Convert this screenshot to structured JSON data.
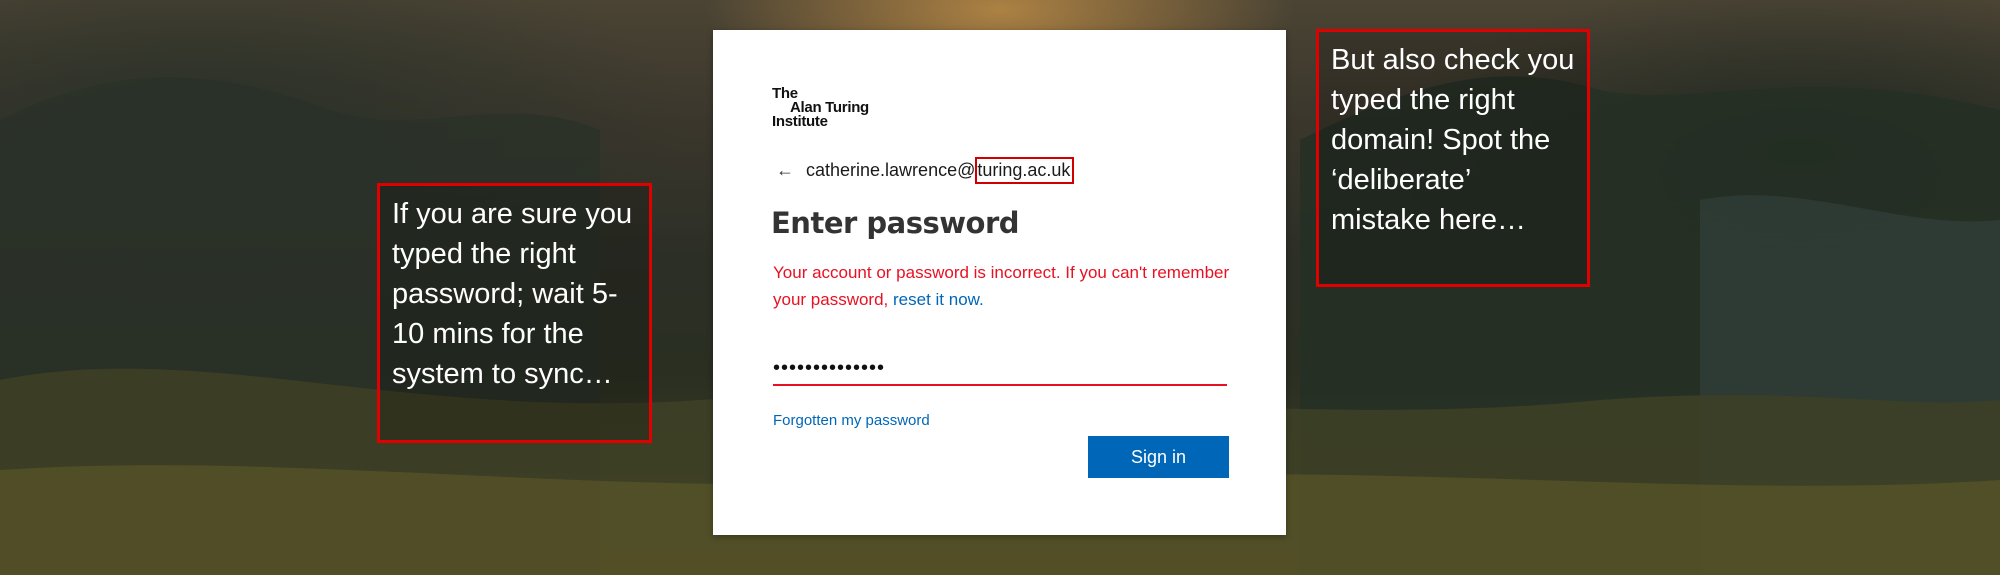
{
  "login": {
    "logo_line1": "The",
    "logo_line2": "Alan Turing",
    "logo_line3": "Institute",
    "back_arrow": "←",
    "user_prefix": "catherine.lawrence@",
    "user_domain": "turing.ac.uk",
    "title": "Enter password",
    "error_text": "Your account or password is incorrect. If you can't remember your password, ",
    "error_link": "reset it now.",
    "password_value": "••••••••••••••",
    "forgot_link": "Forgotten my password",
    "sign_in_label": "Sign in"
  },
  "annotations": {
    "left_note": "If you are sure you typed the right password; wait 5-10 mins for the system to sync…",
    "right_note": "But also check you typed the right domain! Spot the ‘deliberate’ mistake here…"
  },
  "colors": {
    "accent_blue": "#0067b8",
    "error_red": "#e81123",
    "annotation_red": "#e00000"
  },
  "icons": {
    "back": "arrow-left-icon",
    "pointer": "curved-arrow-icon"
  }
}
